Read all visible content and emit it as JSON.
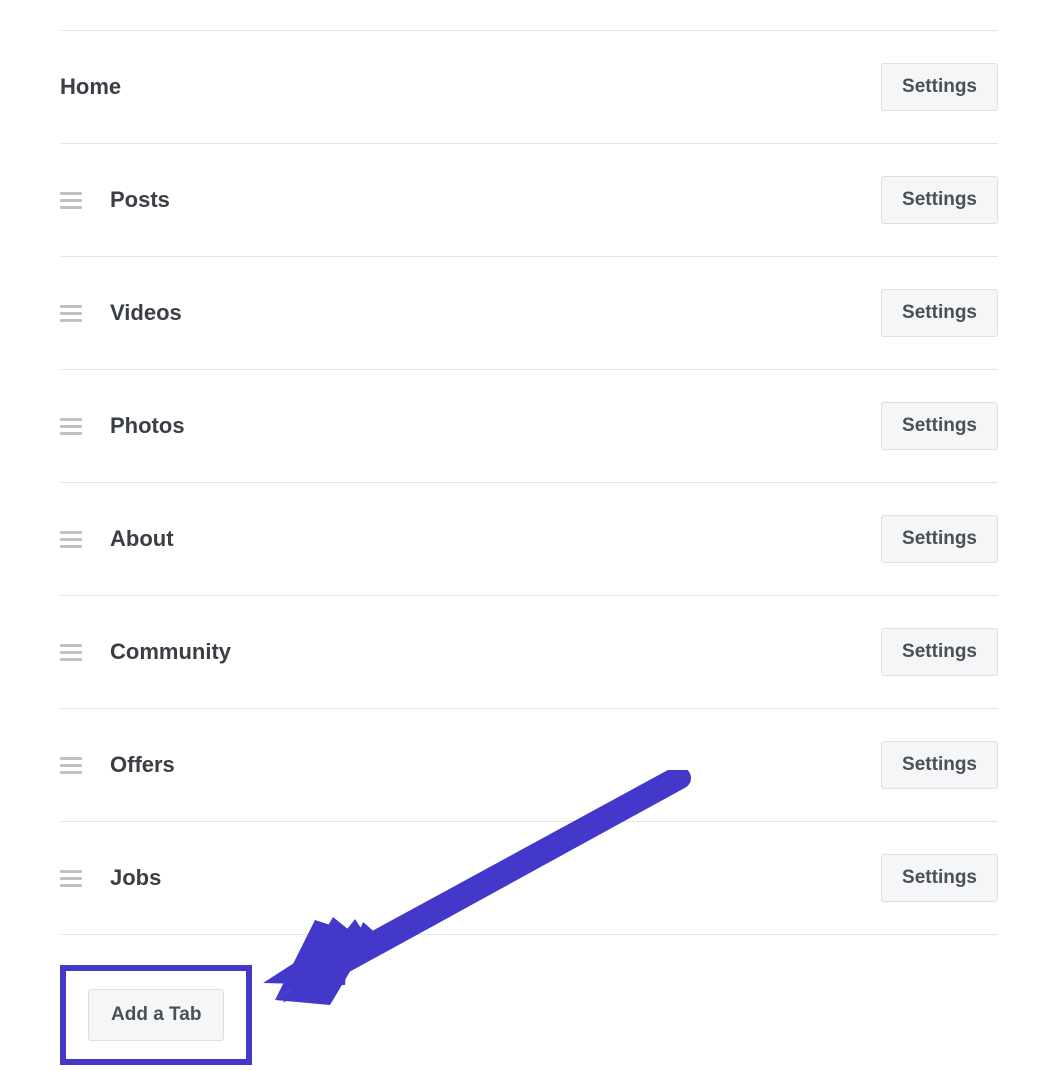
{
  "tabs": [
    {
      "label": "Home",
      "settings_label": "Settings",
      "draggable": false
    },
    {
      "label": "Posts",
      "settings_label": "Settings",
      "draggable": true
    },
    {
      "label": "Videos",
      "settings_label": "Settings",
      "draggable": true
    },
    {
      "label": "Photos",
      "settings_label": "Settings",
      "draggable": true
    },
    {
      "label": "About",
      "settings_label": "Settings",
      "draggable": true
    },
    {
      "label": "Community",
      "settings_label": "Settings",
      "draggable": true
    },
    {
      "label": "Offers",
      "settings_label": "Settings",
      "draggable": true
    },
    {
      "label": "Jobs",
      "settings_label": "Settings",
      "draggable": true
    }
  ],
  "add_tab_label": "Add a Tab",
  "colors": {
    "highlight": "#4338ca",
    "text": "#3a3e45",
    "button_bg": "#f5f6f7",
    "button_border": "#dcdfe3",
    "button_text": "#4b4f56"
  }
}
